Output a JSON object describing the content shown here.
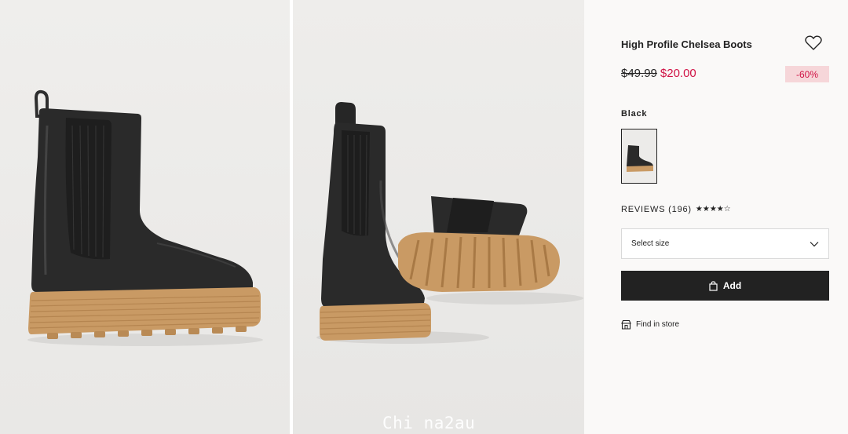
{
  "product": {
    "title": "High Profile Chelsea Boots",
    "old_price": "$49.99",
    "new_price": "$20.00",
    "discount": "-60%",
    "color_label": "Black",
    "reviews_label": "REVIEWS (196)",
    "rating": 4.5,
    "rating_max": 5
  },
  "size_select": {
    "placeholder": "Select size"
  },
  "actions": {
    "add_label": "Add",
    "find_store_label": "Find in store"
  },
  "watermark": "Chi na2au",
  "colors": {
    "sale": "#d01345",
    "discount_bg": "#f6d6d9",
    "button_bg": "#222222",
    "panel_bg": "#faf9f8",
    "sole": "#c99a64",
    "boot": "#2b2b2b"
  }
}
